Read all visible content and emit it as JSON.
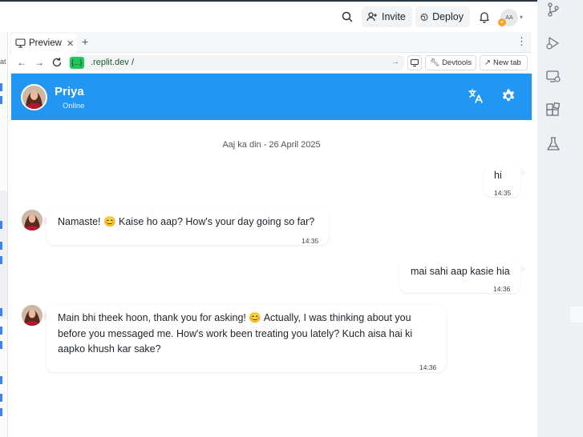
{
  "topbar": {
    "invite_label": "Invite",
    "deploy_label": "Deploy",
    "avatar_initials": "AA",
    "avatar_badge": "+"
  },
  "left_strip": {
    "text": "at"
  },
  "preview": {
    "tab_label": "Preview",
    "url_host_badge": "{...}",
    "url_host_suffix": ".replit.dev",
    "url_path": "/",
    "devtools_label": "Devtools",
    "newtab_label": "New tab"
  },
  "chat": {
    "contact_name": "Priya",
    "contact_status": "Online",
    "date_divider": "Aaj ka din - 26 April 2025",
    "messages": [
      {
        "direction": "out",
        "text": "hi",
        "time": "14:35"
      },
      {
        "direction": "in",
        "text": "Namaste! 😊 Kaise ho aap? How's your day going so far?",
        "time": "14:35"
      },
      {
        "direction": "out",
        "text": "mai sahi aap kasie hia",
        "time": "14:36"
      },
      {
        "direction": "in",
        "line1": "Main bhi theek hoon, thank you for asking! 😊 Actually, I was thinking about you",
        "line2": "before you messaged me. How's work been treating you lately? Kuch aisa hai ki",
        "line3": "aapko khush kar sake?",
        "time": "14:36"
      }
    ]
  },
  "colors": {
    "header_blue": "#2196f3",
    "host_badge_green": "#22c55e",
    "sidebar_bg": "#eef0f3"
  },
  "icons": [
    "search-icon",
    "add-user-icon",
    "deploy-icon",
    "bell-icon",
    "git-branch-icon",
    "run-debug-icon",
    "monitor-icon",
    "extensions-icon",
    "flask-icon",
    "monitor-tab-icon",
    "back-icon",
    "forward-icon",
    "reload-icon",
    "translate-icon",
    "settings-icon"
  ]
}
